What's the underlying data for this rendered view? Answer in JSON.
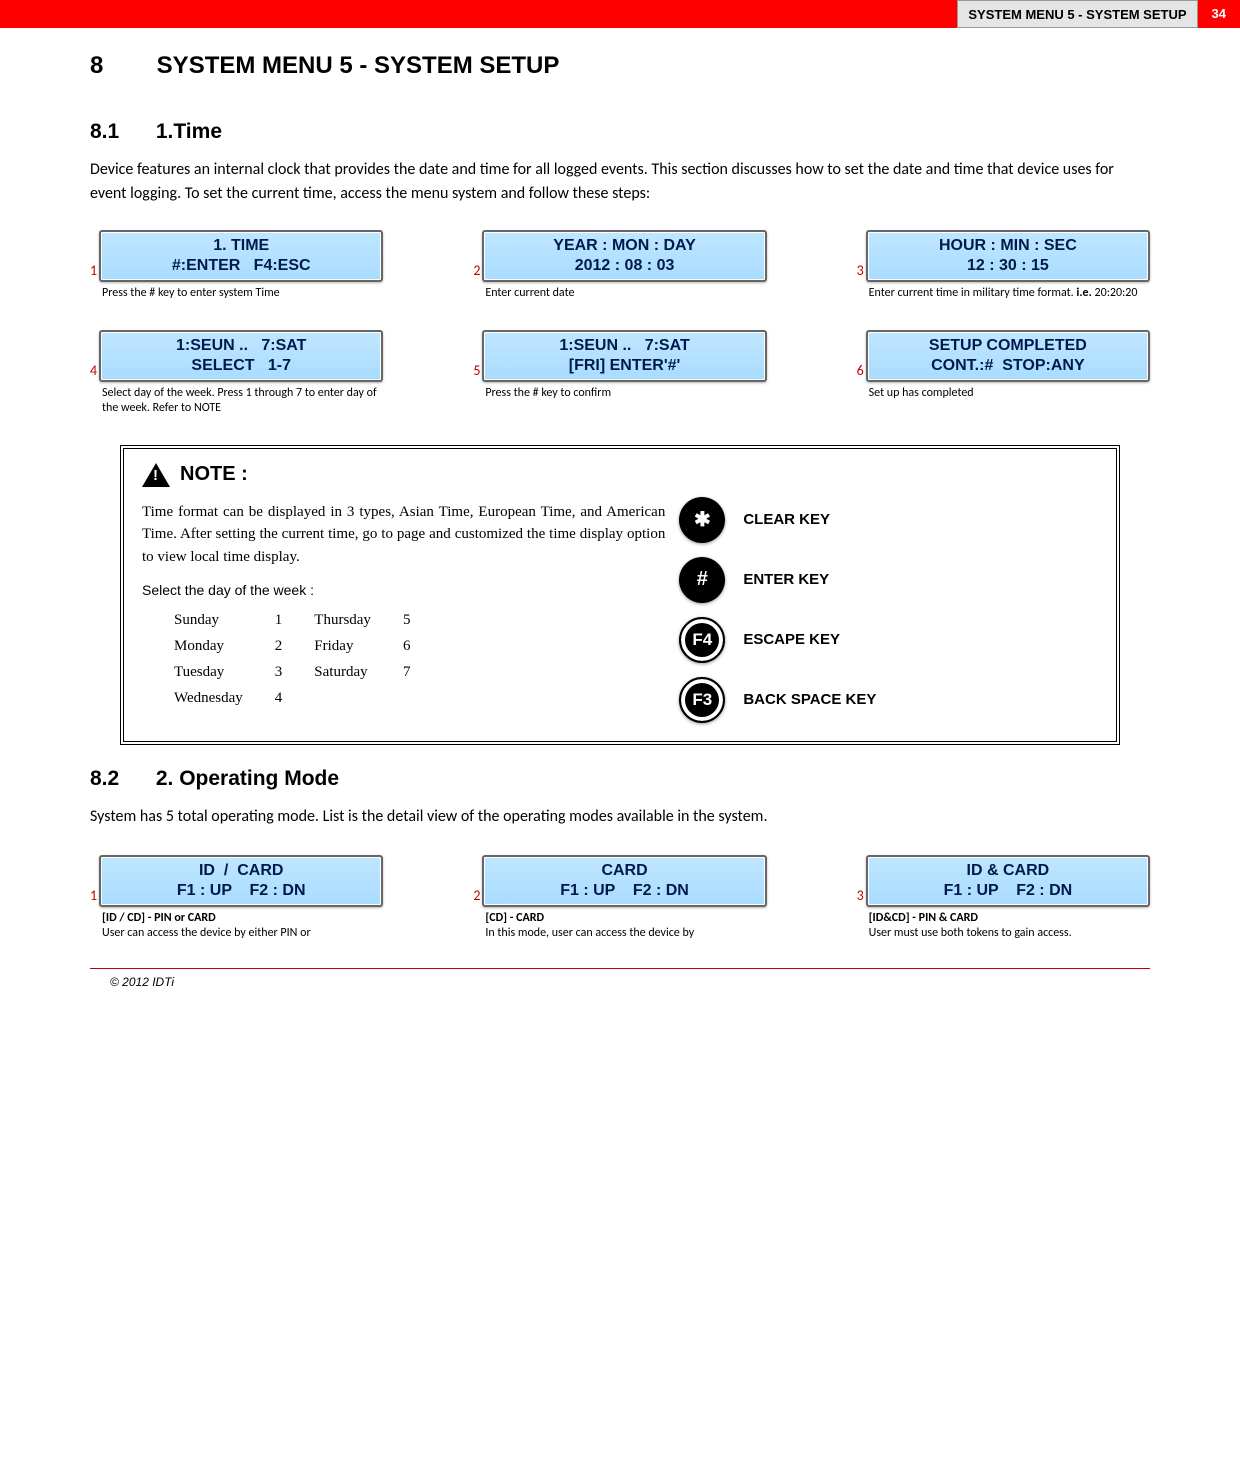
{
  "header": {
    "label": "SYSTEM MENU 5 - SYSTEM SETUP",
    "page": "34"
  },
  "section8": {
    "number": "8",
    "title": "SYSTEM MENU 5 - SYSTEM SETUP"
  },
  "section81": {
    "number": "8.1",
    "title": "1.Time",
    "para": "Device features an internal clock that provides the date and time for all logged events. This section discusses how to set the date and time that device uses for event logging. To set the current time, access the menu system and follow these steps:"
  },
  "time_steps": [
    {
      "n": "1",
      "line1": "1. TIME",
      "line2": "#:ENTER   F4:ESC",
      "cap_html": "Press the # key to enter system Time"
    },
    {
      "n": "2",
      "line1": "YEAR : MON : DAY",
      "line2": "2012 : 08 : 03",
      "cap_html": "Enter current date"
    },
    {
      "n": "3",
      "line1": "HOUR : MIN : SEC",
      "line2": "12 : 30 : 15",
      "cap_html": "Enter current time in military time format. <span class='b'>i.e.</span> 20:20:20"
    },
    {
      "n": "4",
      "line1": "1:SEUN ..   7:SAT",
      "line2": "SELECT   1-7",
      "cap_html": "Select day of the week. Press 1 through 7 to enter day of the week. Refer to NOTE"
    },
    {
      "n": "5",
      "line1": "1:SEUN ..   7:SAT",
      "line2": "[FRI] ENTER'#'",
      "cap_html": "Press the # key to confirm"
    },
    {
      "n": "6",
      "line1": "SETUP COMPLETED",
      "line2": "CONT.:#  STOP:ANY",
      "cap_html": "Set up has completed"
    }
  ],
  "note": {
    "heading": "NOTE :",
    "text": "Time format can be displayed in 3 types, Asian Time, European Time, and American Time. After setting the current time, go to page  and customized the time display option to view local time display.",
    "subheading": "Select the day of the week :",
    "days_col1": [
      [
        "Sunday",
        "1"
      ],
      [
        "Monday",
        "2"
      ],
      [
        "Tuesday",
        "3"
      ],
      [
        "Wednesday",
        "4"
      ]
    ],
    "days_col2": [
      [
        "Thursday",
        "5"
      ],
      [
        "Friday",
        "6"
      ],
      [
        "Saturday",
        "7"
      ]
    ],
    "keys": [
      {
        "glyph": "✱",
        "cls": "",
        "label": "CLEAR KEY"
      },
      {
        "glyph": "#",
        "cls": "",
        "label": "ENTER KEY"
      },
      {
        "glyph": "F4",
        "cls": "fn",
        "label": "ESCAPE KEY"
      },
      {
        "glyph": "F3",
        "cls": "fn",
        "label": "BACK SPACE KEY"
      }
    ]
  },
  "section82": {
    "number": "8.2",
    "title": "2. Operating Mode",
    "para": "System has 5 total operating mode. List is the detail view of the operating modes available in the system."
  },
  "op_steps": [
    {
      "n": "1",
      "line1": "ID  /  CARD",
      "line2": "F1 : UP    F2 : DN",
      "cap_html": "<span class='b'>[ID / CD] - PIN or CARD</span><br>User can access the device by either PIN or"
    },
    {
      "n": "2",
      "line1": "CARD",
      "line2": "F1 : UP    F2 : DN",
      "cap_html": "<span class='b'>[CD] -  CARD</span><br>In this mode, user can access the device by"
    },
    {
      "n": "3",
      "line1": "ID & CARD",
      "line2": "F1 : UP    F2 : DN",
      "cap_html": "<span class='b'>[ID&CD] - PIN & CARD</span><br>User must use both tokens to gain access."
    }
  ],
  "footer": "© 2012 IDTi"
}
